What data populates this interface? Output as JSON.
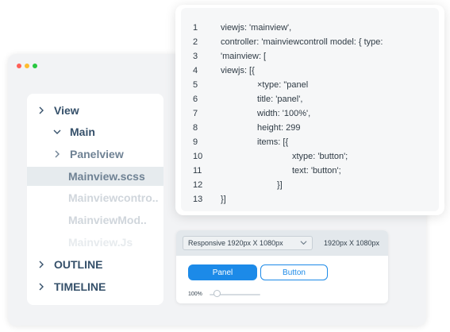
{
  "window": {
    "controls": [
      {
        "name": "close",
        "color": "#ff5f57"
      },
      {
        "name": "minimize",
        "color": "#febc2e"
      },
      {
        "name": "maximize",
        "color": "#28c840"
      }
    ]
  },
  "sidebar": {
    "items": [
      {
        "label": "View",
        "chevron": "right"
      },
      {
        "label": "Main",
        "chevron": "down"
      },
      {
        "label": "Panelview",
        "chevron": "right"
      },
      {
        "label": "Mainview.scss",
        "chevron": "",
        "selected": true
      },
      {
        "label": "Mainviewcontro..",
        "chevron": ""
      },
      {
        "label": "MainviewMod..",
        "chevron": ""
      },
      {
        "label": "Mainview.Js",
        "chevron": ""
      },
      {
        "label": "OUTLINE",
        "chevron": "right"
      },
      {
        "label": "TIMELINE",
        "chevron": "right"
      }
    ]
  },
  "editor": {
    "lines": [
      {
        "num": "1",
        "text": "viewjs: 'mainview',"
      },
      {
        "num": "2",
        "text": "controller: 'mainviewcontroll model: { type:"
      },
      {
        "num": "3",
        "text": "'mainview: ["
      },
      {
        "num": "4",
        "text": "viewjs: [{"
      },
      {
        "num": "5",
        "text": "×type: \"panel"
      },
      {
        "num": "6",
        "text": "title: 'panel',"
      },
      {
        "num": "7",
        "text": "width: '100%',"
      },
      {
        "num": "8",
        "text": "height: 299"
      },
      {
        "num": "9",
        "text": "items: [{"
      },
      {
        "num": "10",
        "text": "xtype: 'button';"
      },
      {
        "num": "11",
        "text": "text: 'button';"
      },
      {
        "num": "12",
        "text": "}]"
      },
      {
        "num": "13",
        "text": "}]"
      }
    ]
  },
  "preview": {
    "device_select": "Responsive 1920px X 1080px",
    "size_label": "1920px X 1080px",
    "panel_button": "Panel",
    "button_button": "Button",
    "zoom_label": "100%",
    "zoom_value": 0.15
  },
  "colors": {
    "accent": "#1c8ae8",
    "sidebar_text": "#35506a",
    "selected_bg": "#e6ebee"
  }
}
